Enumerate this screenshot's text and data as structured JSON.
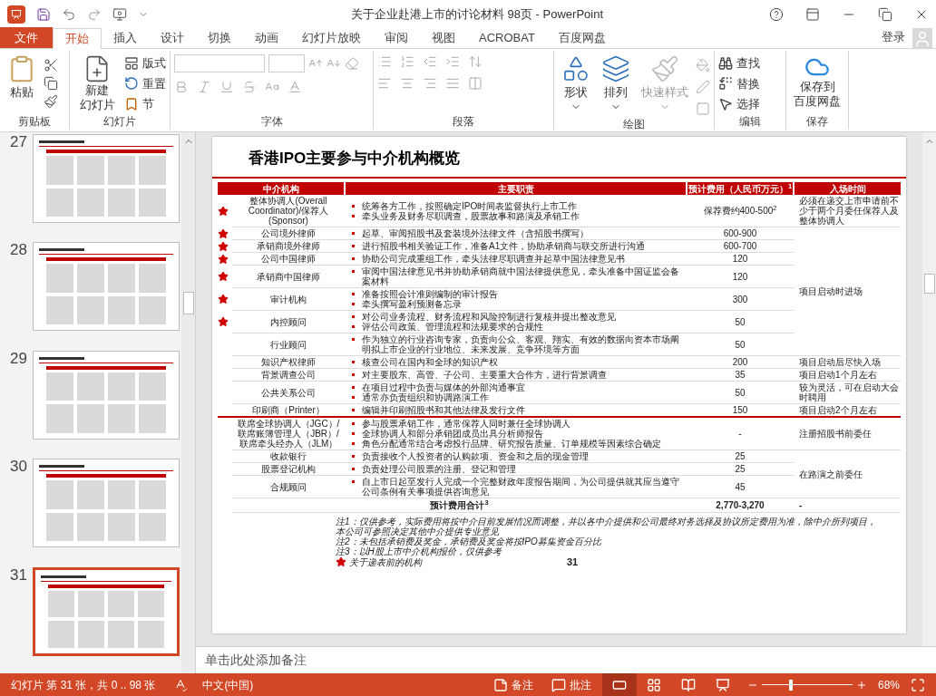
{
  "window": {
    "title": "关于企业赴港上市的讨论材料 98页 - PowerPoint"
  },
  "file_tab": "文件",
  "tabs": [
    {
      "label": "开始",
      "selected": true
    },
    {
      "label": "插入",
      "selected": false
    },
    {
      "label": "设计",
      "selected": false
    },
    {
      "label": "切换",
      "selected": false
    },
    {
      "label": "动画",
      "selected": false
    },
    {
      "label": "幻灯片放映",
      "selected": false
    },
    {
      "label": "审阅",
      "selected": false
    },
    {
      "label": "视图",
      "selected": false
    },
    {
      "label": "ACROBAT",
      "selected": false
    },
    {
      "label": "百度网盘",
      "selected": false
    }
  ],
  "account": "登录",
  "ribbon_groups": [
    {
      "kind": "clipboard",
      "label": "剪贴板",
      "items": [
        "粘贴"
      ]
    },
    {
      "kind": "slides",
      "label": "幻灯片",
      "items": [
        "新建",
        "幻灯片",
        "版式",
        "重置",
        "节"
      ]
    },
    {
      "kind": "font",
      "label": "字体"
    },
    {
      "kind": "paragraph",
      "label": "段落"
    },
    {
      "kind": "drawing",
      "label": "绘图",
      "items": [
        {
          "label": "形状",
          "disabled": false
        },
        {
          "label": "排列",
          "disabled": false
        },
        {
          "label": "快速样式",
          "disabled": true
        }
      ]
    },
    {
      "kind": "editing",
      "label": "编辑",
      "items": [
        "查找",
        "替换",
        "选择"
      ]
    },
    {
      "kind": "save",
      "label": "保存",
      "items": [
        "保存到",
        "百度网盘"
      ]
    }
  ],
  "thumbnails": [
    {
      "number": "27",
      "selected": false
    },
    {
      "number": "28",
      "selected": false
    },
    {
      "number": "29",
      "selected": false
    },
    {
      "number": "30",
      "selected": false
    },
    {
      "number": "31",
      "selected": true
    }
  ],
  "slide": {
    "title": "香港IPO主要参与中介机构概览",
    "table": {
      "columns": [
        "中介机构",
        "主要职责",
        "预计费用（人民币万元）$^{1}$",
        "入场时间"
      ],
      "sections": [
        {
          "groups": [
            {
              "entry": "必须在递交上市申请前不少于两个月委任保荐人及整体协调人",
              "rows": [
                {
                  "key": true,
                  "name": "整体协调人(Overall Coordinator)/保荐人(Sponsor)",
                  "duties": [
                    "统筹各方工作，按照确定IPO时间表监督执行上市工作",
                    "牵头业务及财务尽职调查，股票故事和路演及承销工作"
                  ],
                  "fee": "保荐费约400-500$^{2}$"
                }
              ]
            },
            {
              "entry": "项目启动时进场",
              "rows": [
                {
                  "key": true,
                  "name": "公司境外律师",
                  "duties": [
                    "起草、审阅招股书及套装境外法律文件（含招股书撰写）"
                  ],
                  "fee": "600-900"
                },
                {
                  "key": true,
                  "name": "承销商境外律师",
                  "duties": [
                    "进行招股书相关验证工作，准备A1文件，协助承销商与联交所进行沟通"
                  ],
                  "fee": "600-700"
                },
                {
                  "key": true,
                  "name": "公司中国律师",
                  "duties": [
                    "协助公司完成重组工作，牵头法律尽职调查并起草中国法律意见书"
                  ],
                  "fee": "120"
                },
                {
                  "key": true,
                  "name": "承销商中国律师",
                  "duties": [
                    "审阅中国法律意见书并协助承销商就中国法律提供意见，牵头准备中国证监会备案材料"
                  ],
                  "fee": "120"
                },
                {
                  "key": true,
                  "name": "审计机构",
                  "duties": [
                    "准备按照会计准则编制的审计报告",
                    "牵头撰写盈利预测备忘录"
                  ],
                  "fee": "300"
                },
                {
                  "key": true,
                  "name": "内控顾问",
                  "duties": [
                    "对公司业务流程、财务流程和风险控制进行复核并提出整改意见",
                    "评估公司政策、管理流程和法规要求的合规性"
                  ],
                  "fee": "50"
                },
                {
                  "key": false,
                  "name": "行业顾问",
                  "duties": [
                    "作为独立的行业咨询专家，负责向公众、客观、翔实、有效的数据向资本市场阐明拟上市企业的行业地位、未来发展、竞争环境等方面"
                  ],
                  "fee": "50"
                }
              ]
            },
            {
              "entry": "项目启动后尽快入场",
              "rows": [
                {
                  "key": false,
                  "name": "知识产权律师",
                  "duties": [
                    "核查公司在国内和全球的知识产权"
                  ],
                  "fee": "200"
                }
              ]
            },
            {
              "entry": "项目启动1个月左右",
              "rows": [
                {
                  "key": false,
                  "name": "背景调查公司",
                  "duties": [
                    "对主要股东、高管、子公司、主要重大合作方，进行背景调查"
                  ],
                  "fee": "35"
                }
              ]
            },
            {
              "entry": "较为灵活，可在启动大会时聘用",
              "rows": [
                {
                  "key": false,
                  "name": "公共关系公司",
                  "duties": [
                    "在项目过程中负责与媒体的外部沟通事宜",
                    "通常亦负责组织和协调路演工作"
                  ],
                  "fee": "50"
                }
              ]
            },
            {
              "entry": "项目启动2个月左右",
              "rows": [
                {
                  "key": false,
                  "name": "印刷商（Printer）",
                  "duties": [
                    "编辑并印刷招股书和其他法律及发行文件"
                  ],
                  "fee": "150"
                }
              ]
            }
          ]
        },
        {
          "groups": [
            {
              "entry": "注册招股书前委任",
              "rows": [
                {
                  "key": false,
                  "name": "联席全球协调人（JGC）/联席账簿管理人（JBR）/联席牵头经办人（JLM）",
                  "duties": [
                    "参与股票承销工作，通常保荐人同时兼任全球协调人",
                    "全球协调人和部分承销团成员出具分析师报告",
                    "角色分配通常结合考虑投行品牌、研究报告质量、订单规模等因素综合确定"
                  ],
                  "fee": "-"
                }
              ]
            },
            {
              "entry": "在路演之前委任",
              "rows": [
                {
                  "key": false,
                  "name": "收款银行",
                  "duties": [
                    "负责接收个人投资者的认购款项、资金和之后的现金管理"
                  ],
                  "fee": "25"
                },
                {
                  "key": false,
                  "name": "股票登记机构",
                  "duties": [
                    "负责处理公司股票的注册、登记和管理"
                  ],
                  "fee": "25"
                },
                {
                  "key": false,
                  "name": "合规顾问",
                  "duties": [
                    "自上市日起至发行人完成一个完整财政年度报告期间，为公司提供就其应当遵守公司条例有关事项提供咨询意见"
                  ],
                  "fee": "45"
                }
              ]
            }
          ]
        }
      ],
      "total": {
        "label": "预计费用合计$^{3}$",
        "fee": "2,770-3,270",
        "entry": "-"
      }
    },
    "notes": [
      "注1：仅供参考，实际费用将按中介目前发展情况而调整，并以各中介提供和公司最终对务选择及协议所定费用为准，除中介所列项目，本公司可参照决定其他中介提供专业意见",
      "注2：未包括承销费及奖金，承销费及奖金将按IPO募集资金百分比",
      "注3：以H股上市中介机构报价，仅供参考"
    ],
    "legend": "关于递表前的机构",
    "page_number": "31"
  },
  "notes_placeholder": "单击此处添加备注",
  "status_bar": {
    "slide_info": "幻灯片 第 31 张，共 0 .. 98 张",
    "language": "中文(中国)",
    "notes": "备注",
    "comments": "批注",
    "views": [
      {
        "selected": true
      },
      {
        "selected": false
      },
      {
        "selected": false
      },
      {
        "selected": false
      }
    ],
    "zoom": {
      "level": 0.32
    },
    "zoom_text": "68%"
  }
}
